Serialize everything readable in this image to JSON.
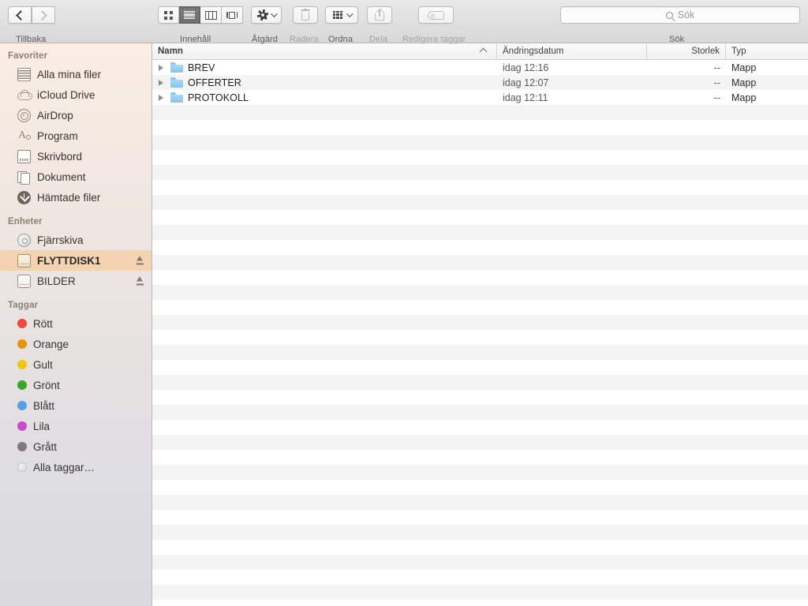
{
  "toolbar": {
    "nav": {
      "back_label": "Tillbaka",
      "back_icon": "chevron-left-icon",
      "forward_icon": "chevron-right-icon"
    },
    "view": {
      "label": "Innehåll",
      "modes": [
        {
          "name": "icon-view",
          "icon": "grid-icon",
          "selected": false
        },
        {
          "name": "list-view",
          "icon": "list-icon",
          "selected": true
        },
        {
          "name": "column-view",
          "icon": "columns-icon",
          "selected": false
        },
        {
          "name": "coverflow-view",
          "icon": "coverflow-icon",
          "selected": false
        }
      ]
    },
    "action": {
      "label": "Åtgärd",
      "icon": "gear-icon",
      "enabled": true
    },
    "delete": {
      "label": "Radera",
      "icon": "trash-icon",
      "enabled": false
    },
    "arrange": {
      "label": "Ordna",
      "icon": "arrange-grid-icon",
      "enabled": true
    },
    "share": {
      "label": "Dela",
      "icon": "share-icon",
      "enabled": false
    },
    "tags": {
      "label": "Redigera taggar",
      "icon": "tag-icon",
      "enabled": false
    },
    "search": {
      "label": "Sök",
      "placeholder": "Sök",
      "value": "",
      "icon": "search-icon"
    }
  },
  "sidebar": {
    "sections": [
      {
        "header": "Favoriter",
        "items": [
          {
            "label": "Alla mina filer",
            "icon": "all-files-icon",
            "selected": false,
            "eject": false
          },
          {
            "label": "iCloud Drive",
            "icon": "cloud-icon",
            "selected": false,
            "eject": false
          },
          {
            "label": "AirDrop",
            "icon": "airdrop-icon",
            "selected": false,
            "eject": false
          },
          {
            "label": "Program",
            "icon": "applications-icon",
            "selected": false,
            "eject": false
          },
          {
            "label": "Skrivbord",
            "icon": "desktop-icon",
            "selected": false,
            "eject": false
          },
          {
            "label": "Dokument",
            "icon": "documents-icon",
            "selected": false,
            "eject": false
          },
          {
            "label": "Hämtade filer",
            "icon": "downloads-icon",
            "selected": false,
            "eject": false
          }
        ]
      },
      {
        "header": "Enheter",
        "items": [
          {
            "label": "Fjärrskiva",
            "icon": "remote-disc-icon",
            "selected": false,
            "eject": false
          },
          {
            "label": "FLYTTDISK1",
            "icon": "external-drive-icon",
            "selected": true,
            "eject": true
          },
          {
            "label": "BILDER",
            "icon": "external-drive-icon",
            "selected": false,
            "eject": true
          }
        ]
      },
      {
        "header": "Taggar",
        "items": [
          {
            "label": "Rött",
            "icon": "tag-dot-icon",
            "color": "#f2453d",
            "selected": false
          },
          {
            "label": "Orange",
            "icon": "tag-dot-icon",
            "color": "#e8930c",
            "selected": false
          },
          {
            "label": "Gult",
            "icon": "tag-dot-icon",
            "color": "#f0c514",
            "selected": false
          },
          {
            "label": "Grönt",
            "icon": "tag-dot-icon",
            "color": "#3aa72b",
            "selected": false
          },
          {
            "label": "Blått",
            "icon": "tag-dot-icon",
            "color": "#5b9fe3",
            "selected": false
          },
          {
            "label": "Lila",
            "icon": "tag-dot-icon",
            "color": "#cb49cb",
            "selected": false
          },
          {
            "label": "Grått",
            "icon": "tag-dot-icon",
            "color": "#7c7c7c",
            "selected": false
          },
          {
            "label": "Alla taggar…",
            "icon": "all-tags-icon",
            "color": "",
            "selected": false
          }
        ]
      }
    ]
  },
  "filelist": {
    "columns": [
      {
        "label": "Namn",
        "sorted": true,
        "sort_direction": "ascending"
      },
      {
        "label": "Ändringsdatum",
        "sorted": false
      },
      {
        "label": "Storlek",
        "sorted": false
      },
      {
        "label": "Typ",
        "sorted": false
      }
    ],
    "rows": [
      {
        "name": "BREV",
        "date": "idag 12:16",
        "size": "--",
        "type": "Mapp",
        "icon": "folder-icon",
        "expandable": true
      },
      {
        "name": "OFFERTER",
        "date": "idag 12:07",
        "size": "--",
        "type": "Mapp",
        "icon": "folder-icon",
        "expandable": true
      },
      {
        "name": "PROTOKOLL",
        "date": "idag 12:11",
        "size": "--",
        "type": "Mapp",
        "icon": "folder-icon",
        "expandable": true
      }
    ],
    "empty_row_count": 33
  },
  "colors": {
    "selection": "#f3d3b0",
    "folder": "#8cc6ea",
    "sidebar_top": "#faeee3",
    "sidebar_bottom": "#d9d9de",
    "stripe": "#f4f4f4"
  }
}
